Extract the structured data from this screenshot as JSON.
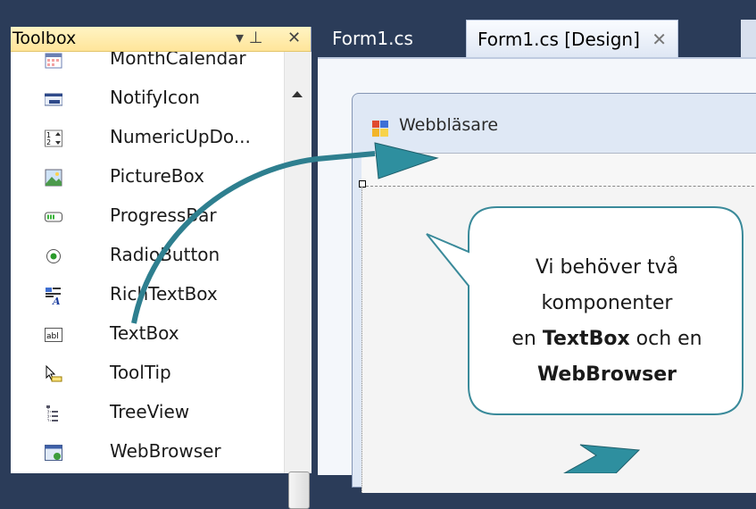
{
  "toolbox": {
    "title": "Toolbox",
    "pin_glyph": "▾ ⊥",
    "close_glyph": "✕",
    "items": [
      {
        "label": "MonthCalendar",
        "icon": "calendar-icon"
      },
      {
        "label": "NotifyIcon",
        "icon": "notify-icon"
      },
      {
        "label": "NumericUpDo...",
        "icon": "numeric-updown-icon"
      },
      {
        "label": "PictureBox",
        "icon": "picture-icon"
      },
      {
        "label": "ProgressBar",
        "icon": "progressbar-icon"
      },
      {
        "label": "RadioButton",
        "icon": "radio-icon"
      },
      {
        "label": "RichTextBox",
        "icon": "richtext-icon"
      },
      {
        "label": "TextBox",
        "icon": "textbox-icon"
      },
      {
        "label": "ToolTip",
        "icon": "tooltip-icon"
      },
      {
        "label": "TreeView",
        "icon": "treeview-icon"
      },
      {
        "label": "WebBrowser",
        "icon": "webbrowser-icon"
      }
    ],
    "textbox_icon_text": "abl"
  },
  "tabs": {
    "form1cs": "Form1.cs",
    "design": "Form1.cs [Design]",
    "close_glyph": "✕"
  },
  "designer": {
    "form_title": "Webbläsare"
  },
  "callout": {
    "line1": "Vi behöver två",
    "line2": "komponenter",
    "line3_prefix": "en ",
    "line3_bold": "TextBox",
    "line3_suffix": " och en",
    "line4_bold": "WebBrowser"
  },
  "colors": {
    "background": "#2b3c59",
    "toolbox_header": "#ffe59a",
    "arrow": "#2e7f8f",
    "callout_border": "#3a8a9a"
  }
}
